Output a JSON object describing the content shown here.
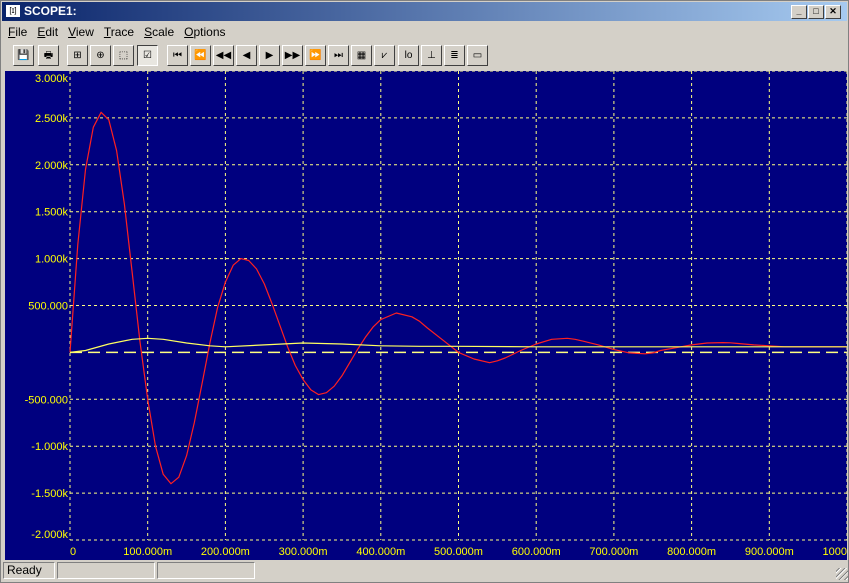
{
  "window": {
    "title": "SCOPE1:",
    "icon": "scope-app-icon",
    "icon_glyph": "[ɪ]"
  },
  "title_buttons": [
    {
      "name": "minimize-button",
      "glyph": "_"
    },
    {
      "name": "maximize-button",
      "glyph": "□"
    },
    {
      "name": "close-button",
      "glyph": "✕"
    }
  ],
  "menu": [
    {
      "key": "F",
      "rest": "ile"
    },
    {
      "key": "E",
      "rest": "dit"
    },
    {
      "key": "V",
      "rest": "iew"
    },
    {
      "key": "T",
      "rest": "race"
    },
    {
      "key": "S",
      "rest": "cale"
    },
    {
      "key": "O",
      "rest": "ptions"
    }
  ],
  "toolbar": [
    {
      "name": "save-icon",
      "glyph": "💾"
    },
    {
      "name": "print-icon",
      "glyph": "🖶"
    },
    {
      "name": "trace-select-icon",
      "glyph": "⊞"
    },
    {
      "name": "zoom-target-icon",
      "glyph": "⊕"
    },
    {
      "name": "select-area-icon",
      "glyph": "⬚"
    },
    {
      "name": "autoscale-check-icon",
      "glyph": "☑",
      "pressed": true
    },
    {
      "name": "first-icon",
      "glyph": "⏮"
    },
    {
      "name": "fast-back-icon",
      "glyph": "⏪"
    },
    {
      "name": "step-back-icon",
      "glyph": "◀◀"
    },
    {
      "name": "back-icon",
      "glyph": "◀"
    },
    {
      "name": "forward-icon",
      "glyph": "▶"
    },
    {
      "name": "step-forward-icon",
      "glyph": "▶▶"
    },
    {
      "name": "fast-forward-icon",
      "glyph": "⏩"
    },
    {
      "name": "last-icon",
      "glyph": "⏭"
    },
    {
      "name": "table-icon",
      "glyph": "▦"
    },
    {
      "name": "linear-scale-icon",
      "glyph": "⩗"
    },
    {
      "name": "log-scale-icon",
      "glyph": "lo"
    },
    {
      "name": "grid-scale-icon",
      "glyph": "⊥"
    },
    {
      "name": "list-icon",
      "glyph": "≣"
    },
    {
      "name": "window-icon",
      "glyph": "▭"
    }
  ],
  "colors": {
    "plot_bg": "#00007f",
    "grid": "#ffff80",
    "axis_text": "#ffff00",
    "trace_red": "#ff2020",
    "trace_yellow": "#ffff60"
  },
  "chart_data": {
    "type": "line",
    "xlim": [
      0,
      1000
    ],
    "ylim": [
      -2000,
      3000
    ],
    "x_ticks": [
      "0",
      "100.000m",
      "200.000m",
      "300.000m",
      "400.000m",
      "500.000m",
      "600.000m",
      "700.000m",
      "800.000m",
      "900.000m",
      "1000"
    ],
    "y_ticks": [
      "3.000k",
      "2.500k",
      "2.000k",
      "1.500k",
      "1.000k",
      "500.000",
      "",
      "-500.000",
      "-1.000k",
      "-1.500k",
      "-2.000k"
    ],
    "grid": true,
    "zero_line": "dashed",
    "series": [
      {
        "color": "red",
        "x": [
          0,
          10,
          20,
          30,
          40,
          50,
          60,
          70,
          80,
          90,
          100,
          110,
          120,
          130,
          140,
          150,
          160,
          170,
          180,
          190,
          200,
          210,
          220,
          230,
          240,
          250,
          260,
          270,
          280,
          290,
          300,
          310,
          320,
          330,
          340,
          350,
          360,
          370,
          380,
          390,
          400,
          420,
          440,
          450,
          460,
          480,
          500,
          520,
          540,
          550,
          560,
          580,
          600,
          620,
          640,
          650,
          660,
          680,
          700,
          720,
          740,
          750,
          760,
          780,
          800,
          820,
          840,
          850,
          860,
          880,
          900,
          920,
          940,
          960,
          980,
          1000
        ],
        "y": [
          0,
          1150,
          1950,
          2400,
          2560,
          2480,
          2150,
          1580,
          850,
          120,
          -500,
          -1000,
          -1300,
          -1400,
          -1330,
          -1100,
          -750,
          -330,
          100,
          480,
          750,
          930,
          1000,
          980,
          890,
          730,
          520,
          290,
          60,
          -140,
          -290,
          -400,
          -450,
          -430,
          -360,
          -250,
          -110,
          30,
          160,
          270,
          350,
          420,
          380,
          330,
          260,
          130,
          0,
          -70,
          -110,
          -90,
          -60,
          20,
          90,
          140,
          150,
          140,
          120,
          80,
          30,
          -5,
          -15,
          -5,
          20,
          50,
          80,
          100,
          105,
          102,
          95,
          80,
          70,
          60,
          60,
          60,
          60,
          60
        ]
      },
      {
        "color": "yellow",
        "x": [
          0,
          20,
          50,
          80,
          100,
          120,
          150,
          180,
          200,
          250,
          300,
          350,
          400,
          450,
          500,
          600,
          700,
          800,
          900,
          1000
        ],
        "y": [
          0,
          20,
          90,
          140,
          150,
          140,
          100,
          70,
          60,
          80,
          100,
          90,
          70,
          65,
          65,
          60,
          60,
          60,
          60,
          60
        ]
      }
    ]
  },
  "status": {
    "ready": "Ready",
    "panel2": "",
    "panel3": ""
  }
}
